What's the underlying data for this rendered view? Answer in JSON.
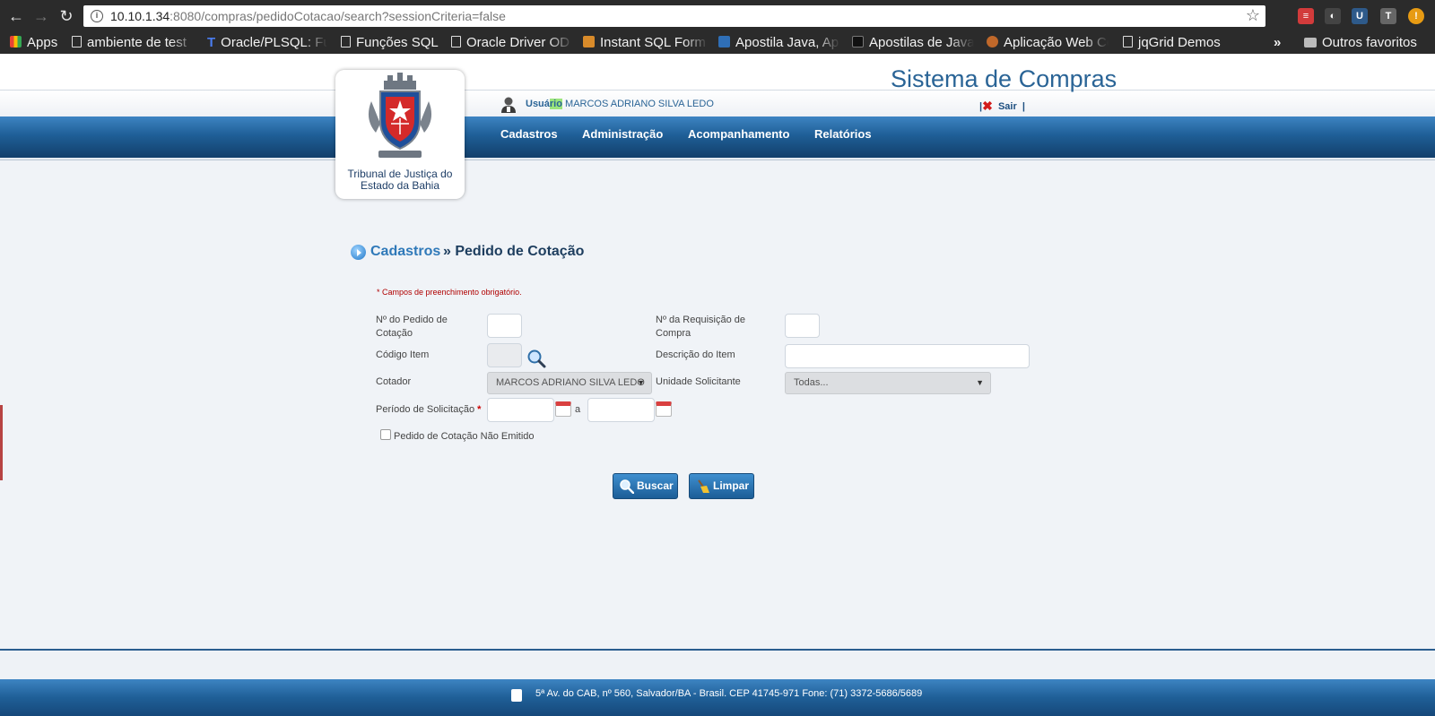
{
  "browser": {
    "url_host": "10.10.1.34",
    "url_rest": ":8080/compras/pedidoCotacao/search?sessionCriteria=false",
    "bookmarks": [
      "Apps",
      "ambiente de test",
      "Oracle/PLSQL: Fu",
      "Funções SQL",
      "Oracle Driver OD",
      "Instant SQL Form",
      "Apostila Java, Ap",
      "Apostilas de Java",
      "Aplicação Web Co",
      "jqGrid Demos"
    ],
    "more": "»",
    "other_bookmarks": "Outros favoritos"
  },
  "header": {
    "system_title": "Sistema de Compras",
    "logo_line1": "Tribunal de Justiça do",
    "logo_line2": "Estado da Bahia",
    "user_prefix": "Usuá",
    "user_highlight": "rio",
    "user_name": "MARCOS ADRIANO SILVA LEDO",
    "logout_pipe_left": "|",
    "logout_label": "Sair",
    "logout_pipe_right": "|",
    "nav": [
      "Cadastros",
      "Administração",
      "Acompanhamento",
      "Relatórios"
    ]
  },
  "breadcrumb": {
    "parent": "Cadastros",
    "current": "» Pedido de Cotação"
  },
  "form": {
    "required_note": "* Campos de preenchimento obrigatório.",
    "pedido_label_1": "Nº do Pedido de",
    "pedido_label_2": "Cotação",
    "requisicao_label_1": "Nº da Requisição de",
    "requisicao_label_2": "Compra",
    "codigo_item_label": "Código Item",
    "descricao_item_label": "Descrição do Item",
    "cotador_label": "Cotador",
    "cotador_value": "MARCOS ADRIANO SILVA LEDO",
    "unidade_label": "Unidade Solicitante",
    "unidade_value": "Todas...",
    "periodo_label": "Período de Solicitação",
    "periodo_required": "*",
    "periodo_sep": "a",
    "checkbox_label": "Pedido de Cotação Não Emitido",
    "checkbox_checked": false,
    "buscar_label": "Buscar",
    "limpar_label": "Limpar"
  },
  "footer": {
    "address": "5ª Av. do CAB, nº 560, Salvador/BA - Brasil. CEP 41745-971 Fone: (71) 3372-5686/5689"
  }
}
